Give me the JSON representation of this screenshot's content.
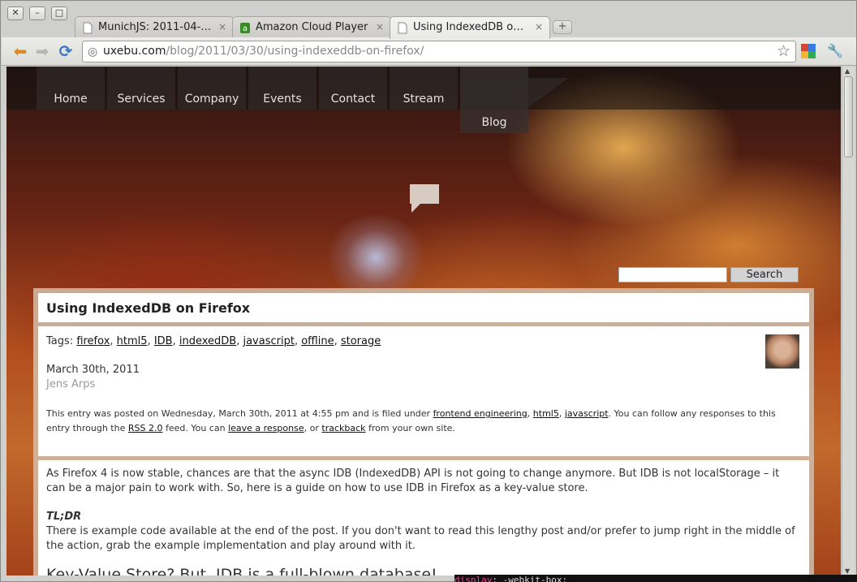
{
  "window": {
    "close_glyph": "✕",
    "min_glyph": "–",
    "max_glyph": "□"
  },
  "tabs": [
    {
      "title": "MunichJS: 2011-04-…",
      "close": "×"
    },
    {
      "title": "Amazon Cloud Player",
      "close": "×"
    },
    {
      "title": "Using IndexedDB o…",
      "close": "×"
    }
  ],
  "new_tab_glyph": "+",
  "toolbar": {
    "back_glyph": "⬅",
    "forward_glyph": "➡",
    "reload_glyph": "⟳",
    "url_host": "uxebu.com",
    "url_path": "/blog/2011/03/30/using-indexeddb-on-firefox/",
    "star_glyph": "☆",
    "wrench_glyph": "🔧"
  },
  "site_nav": [
    "Home",
    "Services",
    "Company",
    "Events",
    "Contact",
    "Stream",
    "Blog"
  ],
  "search": {
    "placeholder": "",
    "button": "Search"
  },
  "post": {
    "title": "Using IndexedDB on Firefox",
    "tags_label": "Tags:",
    "tags": [
      "firefox",
      "html5",
      "IDB",
      "indexedDB",
      "javascript",
      "offline",
      "storage"
    ],
    "date": "March 30th, 2011",
    "author": "Jens Arps",
    "meta_1": "This entry was posted on Wednesday, March 30th, 2011 at 4:55 pm and is filed under",
    "meta_cat1": "frontend engineering",
    "meta_cat2": "html5",
    "meta_cat3": "javascript",
    "meta_2": ". You can follow any responses to this entry through the",
    "meta_rss": "RSS 2.0",
    "meta_3": "feed. You can",
    "meta_leave": "leave a response",
    "meta_4": ", or",
    "meta_trackback": "trackback",
    "meta_5": "from your own site.",
    "para1": "As Firefox 4 is now stable, chances are that the async IDB (IndexedDB) API is not going to change anymore. But IDB is not localStorage – it can be a major pain to work with. So, here is a guide on how to use IDB in Firefox as a key-value store.",
    "tldr": "TL;DR",
    "para2": "There is example code available at the end of the post. If you don't want to read this lengthy post and/or prefer to jump right in the middle of the action, grab the example implementation and play around with it.",
    "heading": "Key-Value Store? But, IDB is a full-blown database!"
  },
  "terminal": {
    "keyword": "display",
    "rest": ": -webkit-box;"
  }
}
